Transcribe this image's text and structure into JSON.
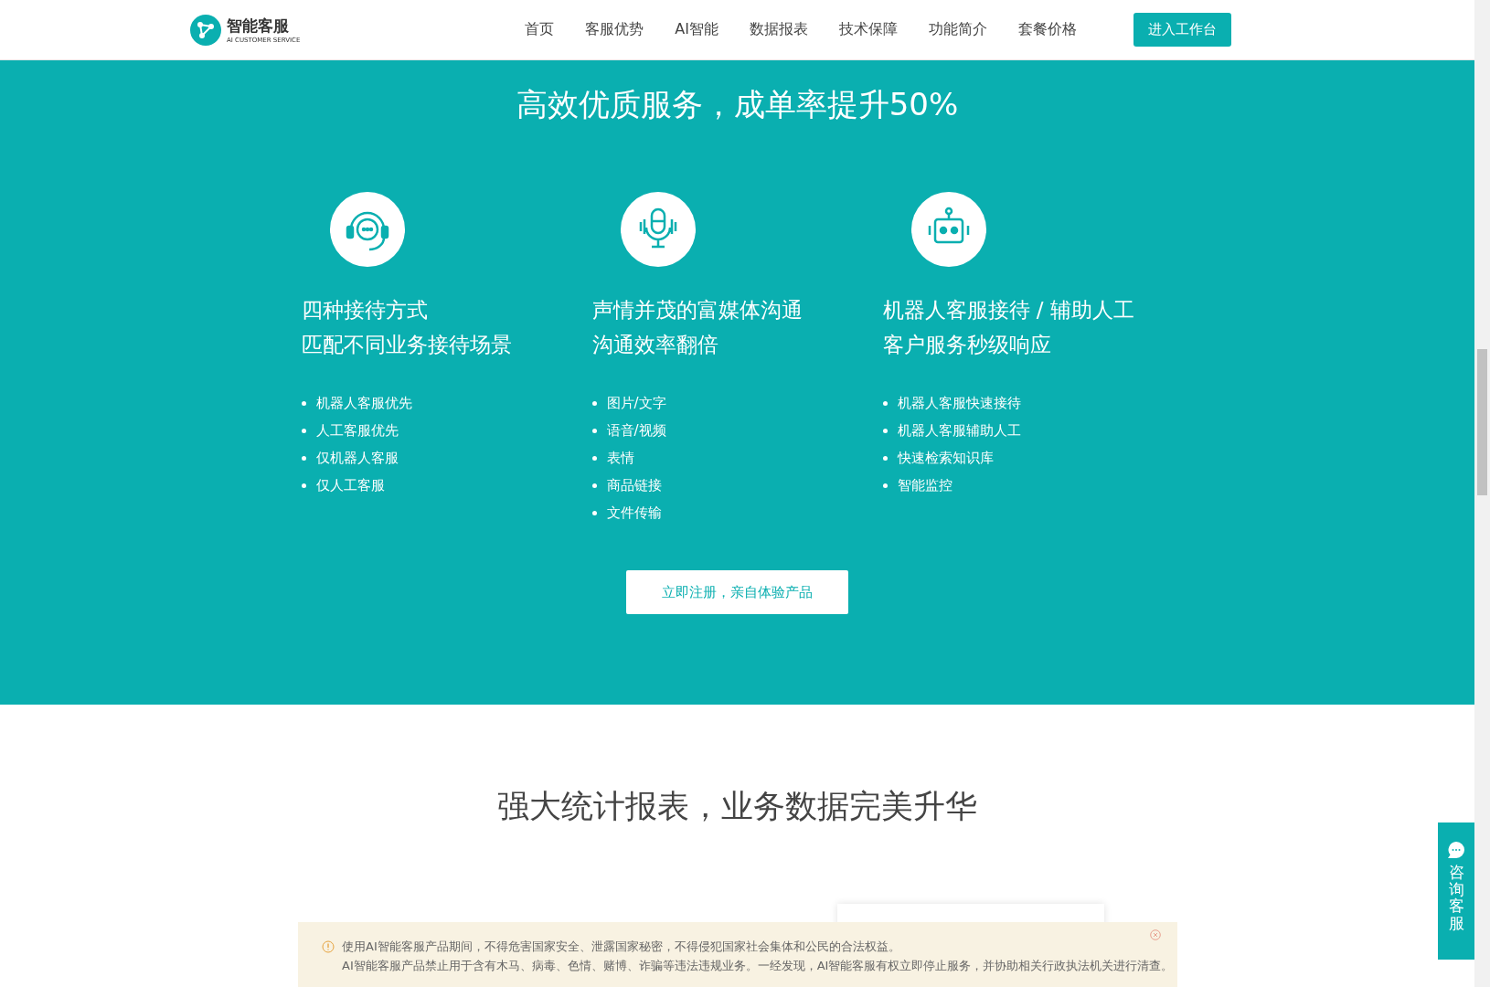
{
  "header": {
    "logo": {
      "title": "智能客服",
      "subtitle": "AI CUSTOMER SERVICE"
    },
    "nav": [
      {
        "label": "首页"
      },
      {
        "label": "客服优势"
      },
      {
        "label": "AI智能"
      },
      {
        "label": "数据报表"
      },
      {
        "label": "技术保障"
      },
      {
        "label": "功能简介"
      },
      {
        "label": "套餐价格"
      }
    ],
    "cta": "进入工作台"
  },
  "hero": {
    "title": "高效优质服务，成单率提升50%",
    "features": [
      {
        "kind": "headset",
        "lines": [
          "四种接待方式",
          "匹配不同业务接待场景"
        ],
        "items": [
          "机器人客服优先",
          "人工客服优先",
          "仅机器人客服",
          "仅人工客服"
        ]
      },
      {
        "kind": "microphone",
        "lines": [
          "声情并茂的富媒体沟通",
          "沟通效率翻倍"
        ],
        "items": [
          "图片/文字",
          "语音/视频",
          "表情",
          "商品链接",
          "文件传输"
        ]
      },
      {
        "kind": "robot",
        "lines": [
          "机器人客服接待 / 辅助人工",
          "客户服务秒级响应"
        ],
        "items": [
          "机器人客服快速接待",
          "机器人客服辅助人工",
          "快速检索知识库",
          "智能监控"
        ]
      }
    ],
    "button": "立即注册，亲自体验产品"
  },
  "reports": {
    "title": "强大统计报表，业务数据完美升华"
  },
  "notice": {
    "lines": [
      "使用AI智能客服产品期间，不得危害国家安全、泄露国家秘密，不得侵犯国家社会集体和公民的合法权益。",
      "AI智能客服产品禁止用于含有木马、病毒、色情、赌博、诈骗等违法违规业务。一经发现，AI智能客服有权立即停止服务，并协助相关行政执法机关进行清查。"
    ]
  },
  "float_button": {
    "label": "咨询客服"
  }
}
